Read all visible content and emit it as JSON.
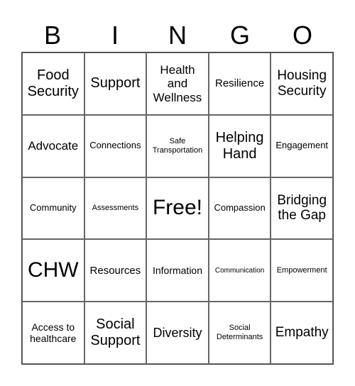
{
  "header": [
    "B",
    "I",
    "N",
    "G",
    "O"
  ],
  "cells": [
    {
      "text": "Food Security",
      "size": 20
    },
    {
      "text": "Support",
      "size": 20
    },
    {
      "text": "Health and Wellness",
      "size": 17
    },
    {
      "text": "Resilience",
      "size": 15
    },
    {
      "text": "Housing Security",
      "size": 19
    },
    {
      "text": "Advocate",
      "size": 17
    },
    {
      "text": "Connections",
      "size": 13
    },
    {
      "text": "Safe Transportation",
      "size": 11
    },
    {
      "text": "Helping Hand",
      "size": 20
    },
    {
      "text": "Engagement",
      "size": 13
    },
    {
      "text": "Community",
      "size": 13
    },
    {
      "text": "Assessments",
      "size": 11
    },
    {
      "text": "Free!",
      "size": 30
    },
    {
      "text": "Compassion",
      "size": 13
    },
    {
      "text": "Bridging the Gap",
      "size": 19
    },
    {
      "text": "CHW",
      "size": 30
    },
    {
      "text": "Resources",
      "size": 15
    },
    {
      "text": "Information",
      "size": 14
    },
    {
      "text": "Communication",
      "size": 10
    },
    {
      "text": "Empowerment",
      "size": 11
    },
    {
      "text": "Access to healthcare",
      "size": 14
    },
    {
      "text": "Social Support",
      "size": 20
    },
    {
      "text": "Diversity",
      "size": 18
    },
    {
      "text": "Social Determinants",
      "size": 11
    },
    {
      "text": "Empathy",
      "size": 19
    }
  ]
}
